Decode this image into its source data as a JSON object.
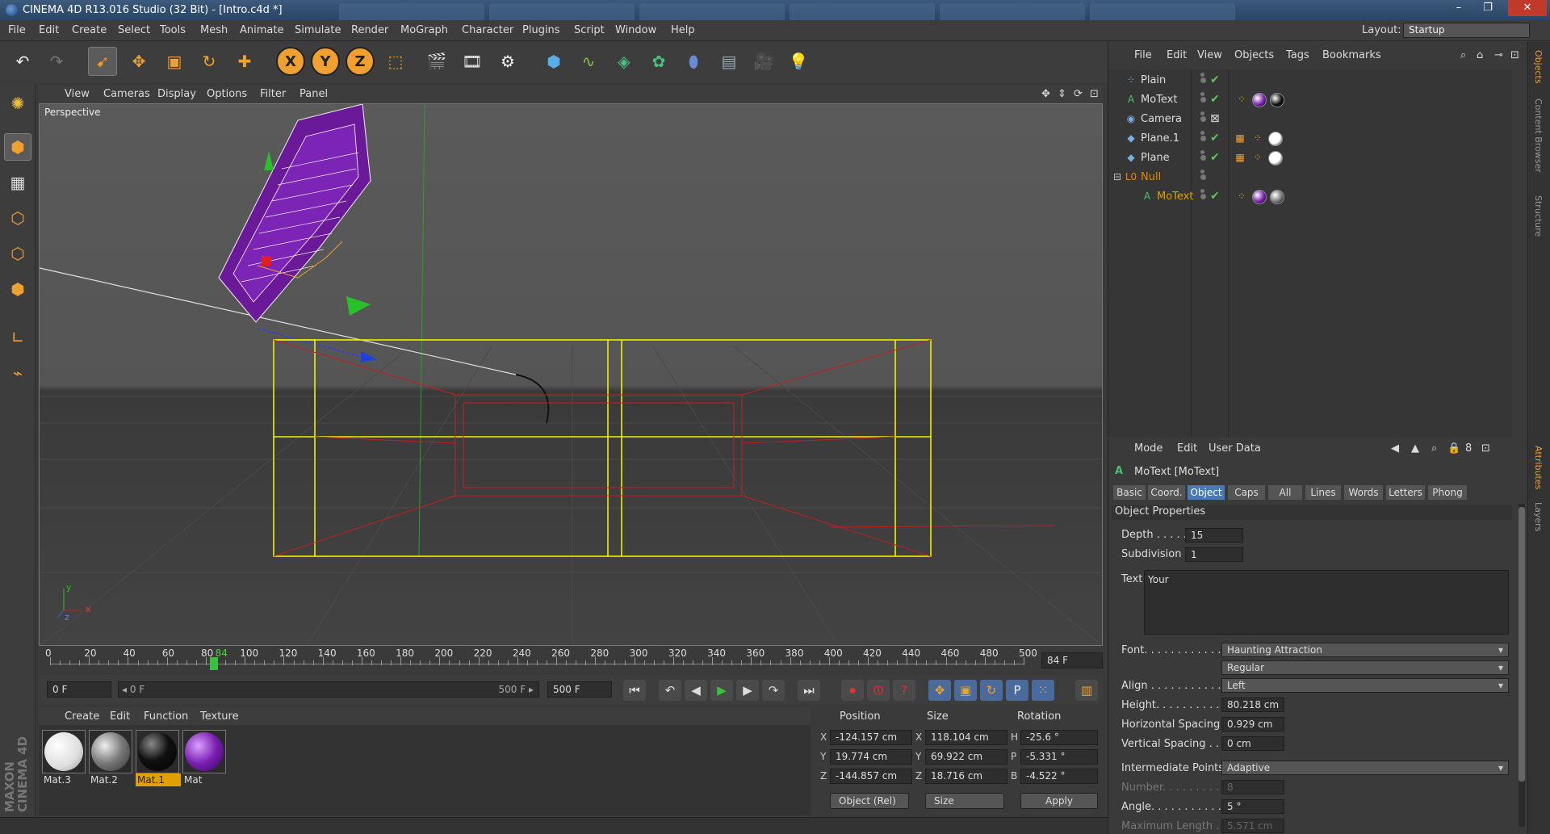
{
  "window": {
    "title": "CINEMA 4D R13.016 Studio (32 Bit) - [Intro.c4d *]",
    "controls": [
      "–",
      "❐",
      "✕"
    ]
  },
  "menubar": [
    "File",
    "Edit",
    "Create",
    "Select",
    "Tools",
    "Mesh",
    "Animate",
    "Simulate",
    "Render",
    "MoGraph",
    "Character",
    "Plugins",
    "Script",
    "Window",
    "Help"
  ],
  "layout": {
    "label": "Layout:",
    "value": "Startup"
  },
  "toolbar": {
    "icons": [
      "undo-icon",
      "redo-icon",
      "live-selection-icon",
      "move-icon",
      "scale-icon",
      "rotate-icon",
      "add-icon",
      "x-axis-icon",
      "y-axis-icon",
      "z-axis-icon",
      "coordinate-system-icon",
      "render-view-icon",
      "render-picture-viewer-icon",
      "edit-render-settings-icon",
      "cube-icon",
      "spline-icon",
      "nurbs-icon",
      "array-icon",
      "deformer-icon",
      "floor-icon",
      "camera-icon",
      "light-icon"
    ],
    "axis_labels": [
      "X",
      "Y",
      "Z"
    ]
  },
  "leftbar": [
    "make-editable-icon",
    "model-mode-icon",
    "texture-mode-icon",
    "points-mode-icon",
    "edges-mode-icon",
    "polygons-mode-icon",
    "axis-mode-icon",
    "tweak-mode-icon"
  ],
  "viewport": {
    "menu": [
      "View",
      "Cameras",
      "Display",
      "Options",
      "Filter",
      "Panel"
    ],
    "label": "Perspective",
    "axis": {
      "x": "x",
      "y": "y",
      "z": "z"
    }
  },
  "timeline": {
    "ticks": [
      "0",
      "20",
      "40",
      "60",
      "80",
      "84",
      "100",
      "120",
      "140",
      "160",
      "180",
      "200",
      "220",
      "240",
      "260",
      "280",
      "300",
      "320",
      "340",
      "360",
      "380",
      "400",
      "420",
      "440",
      "460",
      "480",
      "500"
    ],
    "current_frame_display": "84 F",
    "current_frame": 84,
    "min_frame": 0,
    "max_frame": 500
  },
  "transport": {
    "start": "0 F",
    "range_start": "◂ 0 F",
    "range_end": "500 F ▸",
    "end": "500 F",
    "buttons": [
      "go-to-start-icon",
      "previous-key-icon",
      "previous-frame-icon",
      "play-icon",
      "next-frame-icon",
      "next-key-icon",
      "go-to-end-icon",
      "record-icon",
      "autokey-icon",
      "keyframe-selection-icon",
      "move-key-icon",
      "scale-key-icon",
      "rotate-key-icon",
      "parameter-key-icon",
      "pla-key-icon",
      "timeline-icon"
    ]
  },
  "materials": {
    "menu": [
      "Create",
      "Edit",
      "Function",
      "Texture"
    ],
    "items": [
      {
        "name": "Mat.3",
        "color": "#ffffff",
        "selected": false
      },
      {
        "name": "Mat.2",
        "color": "#9a9a9a",
        "selected": false
      },
      {
        "name": "Mat.1",
        "color": "#111111",
        "selected": true
      },
      {
        "name": "Mat",
        "color": "#7a1fb0",
        "selected": false
      }
    ],
    "brand": "MAXON CINEMA 4D"
  },
  "coordinates": {
    "headers": [
      "Position",
      "Size",
      "Rotation"
    ],
    "rows": [
      {
        "axis": "X",
        "pos": "-124.157 cm",
        "size_axis": "X",
        "size": "118.104 cm",
        "rot_axis": "H",
        "rot": "-25.6 °"
      },
      {
        "axis": "Y",
        "pos": "19.774 cm",
        "size_axis": "Y",
        "size": "69.922 cm",
        "rot_axis": "P",
        "rot": "-5.331 °"
      },
      {
        "axis": "Z",
        "pos": "-144.857 cm",
        "size_axis": "Z",
        "size": "18.716 cm",
        "rot_axis": "B",
        "rot": "-4.522 °"
      }
    ],
    "mode": "Object (Rel)",
    "size_mode": "Size",
    "apply": "Apply"
  },
  "object_manager": {
    "menu": [
      "File",
      "Edit",
      "View",
      "Objects",
      "Tags",
      "Bookmarks"
    ],
    "objects": [
      {
        "name": "Plain",
        "indent": 0,
        "highlight": false,
        "color": "#dddddd",
        "icon": "⁘",
        "tags": []
      },
      {
        "name": "MoText",
        "indent": 0,
        "highlight": false,
        "color": "#dddddd",
        "icon": "A",
        "tags": [
          "#7a1fb0",
          "#111111"
        ]
      },
      {
        "name": "Camera",
        "indent": 0,
        "highlight": false,
        "color": "#dddddd",
        "icon": "◉",
        "tags": []
      },
      {
        "name": "Plane.1",
        "indent": 0,
        "highlight": false,
        "color": "#dddddd",
        "icon": "◆",
        "tags": [
          "#ffffff"
        ]
      },
      {
        "name": "Plane",
        "indent": 0,
        "highlight": false,
        "color": "#dddddd",
        "icon": "◆",
        "tags": [
          "#ffffff"
        ]
      },
      {
        "name": "Null",
        "indent": 0,
        "highlight": true,
        "color": "#e08a00",
        "icon": "L0",
        "tags": []
      },
      {
        "name": "MoText",
        "indent": 1,
        "highlight": true,
        "color": "#e0a000",
        "icon": "A",
        "tags": [
          "#7a1fb0",
          "#777777"
        ]
      }
    ]
  },
  "attributes": {
    "menu": [
      "Mode",
      "Edit",
      "User Data"
    ],
    "object_title": "MoText [MoText]",
    "tabs": [
      "Basic",
      "Coord.",
      "Object",
      "Caps",
      "All",
      "Lines",
      "Words",
      "Letters",
      "Phong"
    ],
    "active_tab": "Object",
    "section": "Object Properties",
    "depth": {
      "label": "Depth . . . . .",
      "value": "15"
    },
    "subdivision": {
      "label": "Subdivision",
      "value": "1"
    },
    "text": {
      "label": "Text",
      "value": "Your"
    },
    "font": {
      "label": "Font. . . . . . . . . . . .",
      "family": "Haunting Attraction",
      "style": "Regular"
    },
    "align": {
      "label": "Align . . . . . . . . . . . . .",
      "value": "Left"
    },
    "height": {
      "label": "Height. . . . . . . . . . . .",
      "value": "80.218 cm"
    },
    "hspacing": {
      "label": "Horizontal Spacing",
      "value": "0.929 cm"
    },
    "vspacing": {
      "label": "Vertical Spacing . . .",
      "value": "0 cm"
    },
    "intermediate": {
      "label": "Intermediate Points",
      "value": "Adaptive"
    },
    "number": {
      "label": "Number. . . . . . . . . . .",
      "value": "8"
    },
    "angle": {
      "label": "Angle. . . . . . . . . . . .",
      "value": "5 °"
    },
    "maxlen": {
      "label": "Maximum Length . . .",
      "value": "5.571 cm"
    }
  },
  "right_tabs": [
    "Objects",
    "Content Browser",
    "Structure",
    "Attributes",
    "Layers"
  ],
  "colors": {
    "accent": "#4a7ab3",
    "selection": "#e0a000",
    "bbox": "#f0f000",
    "wire": "#c02020"
  }
}
